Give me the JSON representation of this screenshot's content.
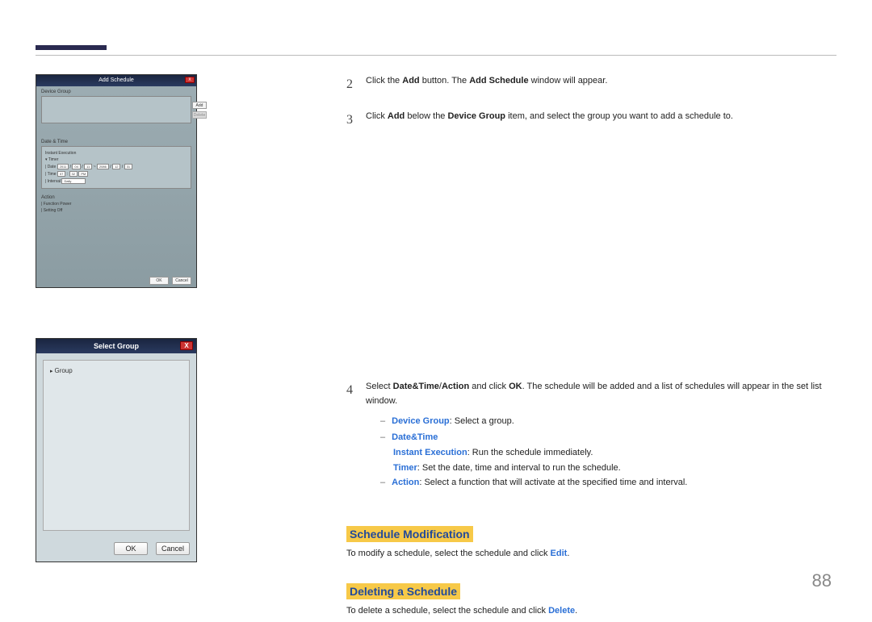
{
  "page_number": "88",
  "shot1": {
    "title": "Add Schedule",
    "close": "X",
    "device_group_label": "Device Group",
    "add_btn": "Add",
    "delete_btn": "Delete",
    "date_time_label": "Date & Time",
    "instant_execution": "Instant Execution",
    "timer_label": "▾ Timer",
    "date_label": "| Date",
    "date_y": "2011",
    "date_m": "04",
    "date_d": "11",
    "date_sep": "~",
    "date_y2": "2086",
    "date_m2": "12",
    "date_d2": "31",
    "time_label": "| Time",
    "time_h": "07",
    "time_m": "32",
    "time_ampm": "PM",
    "interval_label": "| Interval",
    "interval_val": "Daily",
    "action_label": "Action",
    "function_label": "| Function",
    "function_val": "Power",
    "setting_label": "| Setting",
    "setting_val": "Off",
    "ok": "OK",
    "cancel": "Cancel"
  },
  "shot2": {
    "title": "Select Group",
    "close": "X",
    "group": "Group",
    "ok": "OK",
    "cancel": "Cancel"
  },
  "steps": {
    "s2_num": "2",
    "s2_pre": "Click the ",
    "s2_b1": "Add",
    "s2_mid": " button. The ",
    "s2_b2": "Add Schedule",
    "s2_post": " window will appear.",
    "s3_num": "3",
    "s3_pre": "Click ",
    "s3_b1": "Add",
    "s3_mid": " below the ",
    "s3_b2": "Device Group",
    "s3_post": " item, and select the group you want to add a schedule to.",
    "s4_num": "4",
    "s4_pre": "Select ",
    "s4_b1": "Date&Time",
    "s4_slash": "/",
    "s4_b2": "Action",
    "s4_mid": " and click ",
    "s4_b3": "OK",
    "s4_post": ". The schedule will be added and a list of schedules will appear in the set list window."
  },
  "bullets": {
    "device_group_k": "Device Group",
    "device_group_v": ": Select a group.",
    "date_time": "Date&Time",
    "instant_k": "Instant Execution",
    "instant_v": ": Run the schedule immediately.",
    "timer_k": "Timer",
    "timer_v": ": Set the date, time and interval to run the schedule.",
    "action_k": "Action",
    "action_v": ": Select a function that will activate at the specified time and interval."
  },
  "sections": {
    "mod_title": "Schedule Modification",
    "mod_pre": "To modify a schedule, select the schedule and click ",
    "mod_b": "Edit",
    "mod_post": ".",
    "del_title": "Deleting a Schedule",
    "del_pre": "To delete a schedule, select the schedule and click ",
    "del_b": "Delete",
    "del_post": "."
  }
}
